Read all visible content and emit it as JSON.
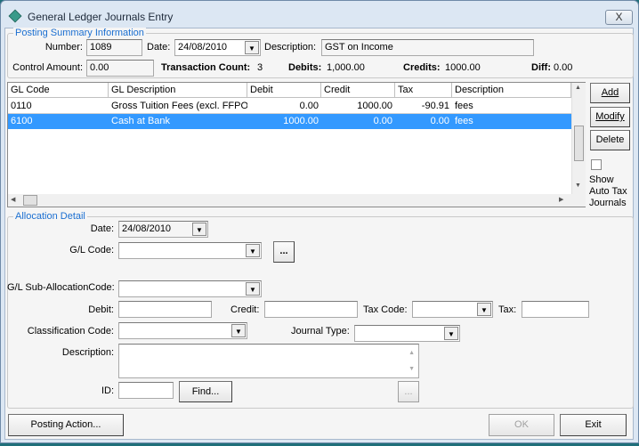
{
  "window": {
    "title": "General Ledger Journals Entry",
    "close_label": "X"
  },
  "summary": {
    "group_label": "Posting Summary Information",
    "number_label": "Number:",
    "number": "1089",
    "date_label": "Date:",
    "date": "24/08/2010",
    "description_label": "Description:",
    "description": "GST on Income",
    "control_amount_label": "Control Amount:",
    "control_amount": "0.00",
    "transaction_count_label": "Transaction Count:",
    "transaction_count": "3",
    "debits_label": "Debits:",
    "debits": "1,000.00",
    "credits_label": "Credits:",
    "credits": "1000.00",
    "diff_label": "Diff:",
    "diff": "0.00"
  },
  "grid": {
    "columns": [
      "GL Code",
      "GL Description",
      "Debit",
      "Credit",
      "Tax",
      "Description"
    ],
    "rows": [
      [
        "0110",
        "Gross Tuition Fees (excl. FFPOS",
        "0.00",
        "1000.00",
        "-90.91",
        "fees"
      ],
      [
        "6100",
        "Cash at Bank",
        "1000.00",
        "0.00",
        "0.00",
        "fees"
      ]
    ],
    "selected_row": 1
  },
  "side": {
    "add": "Add",
    "modify": "Modify",
    "delete": "Delete",
    "show_auto_tax": "Show Auto Tax Journals",
    "show_auto_tax_checked": false
  },
  "allocation": {
    "group_label": "Allocation Detail",
    "date_label": "Date:",
    "date": "24/08/2010",
    "gl_code_label": "G/L Code:",
    "gl_code": "",
    "ellipsis": "...",
    "sub_alloc_label": "G/L Sub-AllocationCode:",
    "sub_alloc": "",
    "debit_label": "Debit:",
    "debit": "",
    "credit_label": "Credit:",
    "credit": "",
    "tax_code_label": "Tax Code:",
    "tax_code": "",
    "tax_label": "Tax:",
    "tax": "",
    "classification_label": "Classification Code:",
    "classification": "",
    "journal_type_label": "Journal Type:",
    "journal_type": "",
    "description_label": "Description:",
    "description": "",
    "id_label": "ID:",
    "id": "",
    "find": "Find..."
  },
  "footer": {
    "posting_action": "Posting Action...",
    "ok": "OK",
    "exit": "Exit"
  }
}
